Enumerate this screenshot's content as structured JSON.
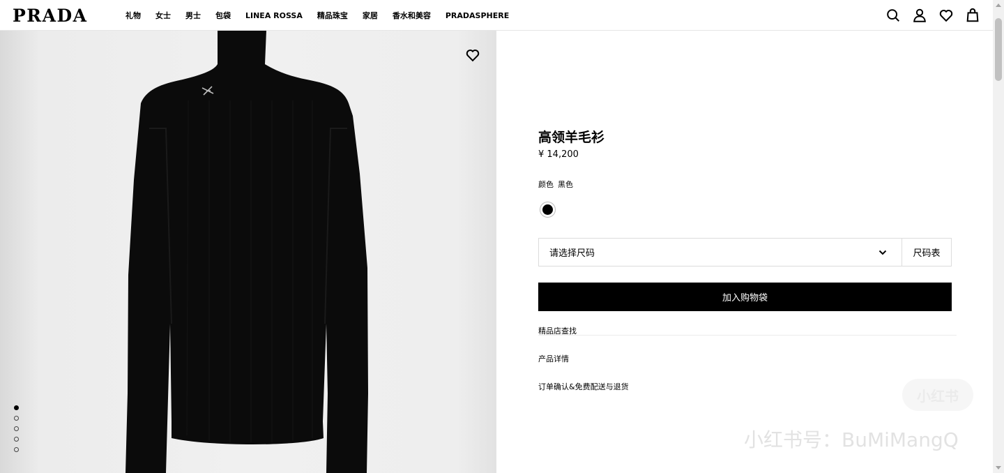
{
  "brand": {
    "logo": "PRADA"
  },
  "nav": {
    "items": [
      "礼物",
      "女士",
      "男士",
      "包袋",
      "LINEA ROSSA",
      "精品珠宝",
      "家居",
      "香水和美容",
      "PRADASPHERE"
    ]
  },
  "header_icons": [
    "search-icon",
    "account-icon",
    "wishlist-icon",
    "shopping-bag-icon"
  ],
  "gallery": {
    "image": "black-turtleneck-sweater",
    "slide_count": 5,
    "active_slide": 1
  },
  "product": {
    "title": "高领羊毛衫",
    "price": "¥ 14,200",
    "color_label": "颜色",
    "color_value": "黑色",
    "swatch_color": "#000000",
    "size_placeholder": "请选择尺码",
    "size_guide": "尺码表",
    "add_to_bag": "加入购物袋",
    "links": [
      "精品店查找",
      "产品详情",
      "订单确认&免费配送与退货"
    ]
  },
  "watermark": {
    "badge": "小红书",
    "text": "小红书号：BuMiMangQ"
  }
}
